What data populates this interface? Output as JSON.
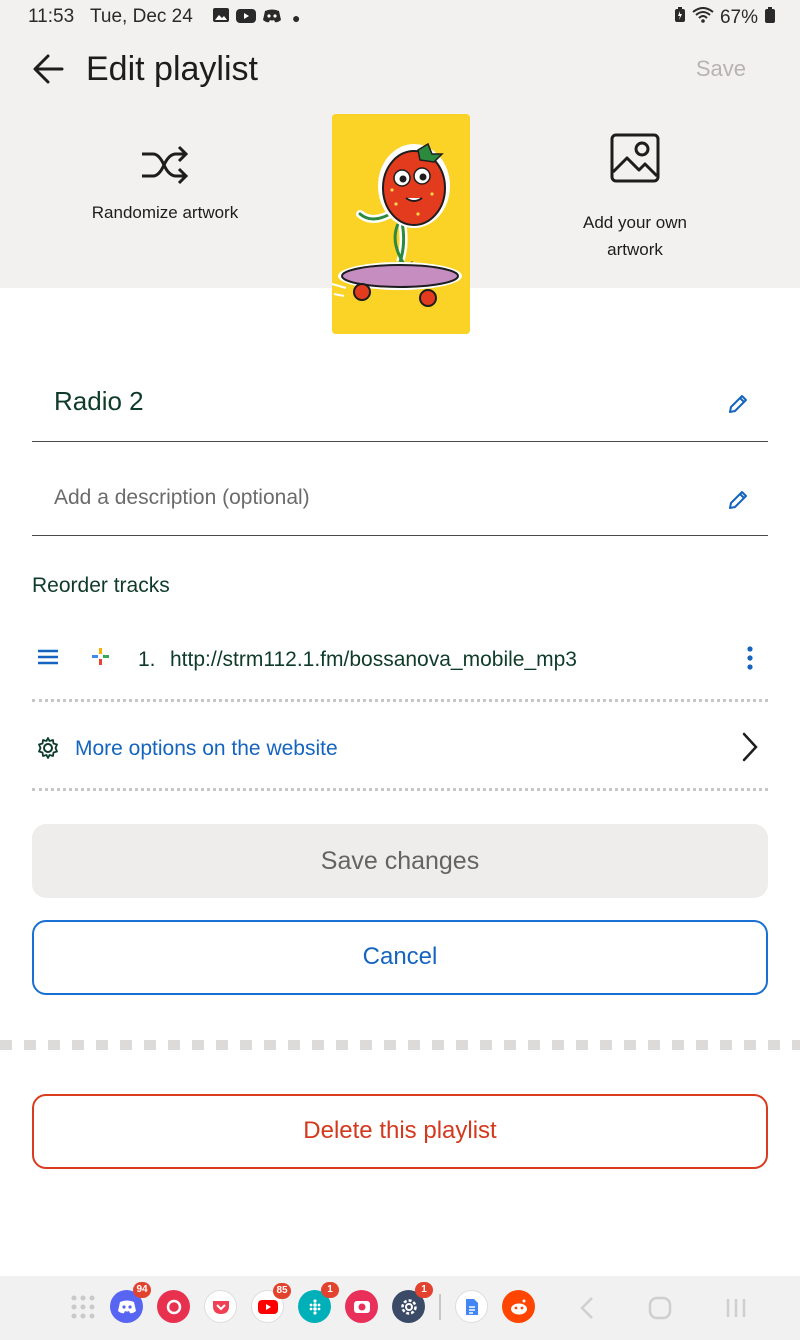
{
  "status_bar": {
    "time": "11:53",
    "date": "Tue, Dec 24",
    "battery": "67%"
  },
  "header": {
    "title": "Edit playlist",
    "save_label": "Save"
  },
  "artwork": {
    "randomize_label": "Randomize artwork",
    "add_own_line1": "Add your own",
    "add_own_line2": "artwork"
  },
  "form": {
    "title_value": "Radio 2",
    "description_placeholder": "Add a description (optional)"
  },
  "tracks": {
    "section_title": "Reorder tracks",
    "items": [
      {
        "number": "1.",
        "url": "http://strm112.1.fm/bossanova_mobile_mp3"
      }
    ]
  },
  "more_options": {
    "label": "More options on the website"
  },
  "buttons": {
    "save_changes": "Save changes",
    "cancel": "Cancel",
    "delete": "Delete this playlist"
  },
  "dock": {
    "apps": [
      {
        "name": "discord",
        "badge": "94",
        "color": "#5865f2"
      },
      {
        "name": "app-pink",
        "badge": "",
        "color": "#e8304f"
      },
      {
        "name": "pocket",
        "badge": "",
        "color": "#ef4056"
      },
      {
        "name": "youtube",
        "badge": "85",
        "color": "#ff0000"
      },
      {
        "name": "fitbit",
        "badge": "1",
        "color": "#00b0b9"
      },
      {
        "name": "camera-app",
        "badge": "",
        "color": "#e8305a"
      },
      {
        "name": "settings",
        "badge": "1",
        "color": "#3b4a66"
      },
      {
        "name": "docs",
        "badge": "",
        "color": "#4285f4"
      },
      {
        "name": "reddit",
        "badge": "",
        "color": "#ff4500"
      }
    ]
  },
  "colors": {
    "accent_blue": "#1565c0",
    "danger_red": "#d4391d",
    "dark_green": "#0f3b2a",
    "cover_yellow": "#fbd326"
  }
}
